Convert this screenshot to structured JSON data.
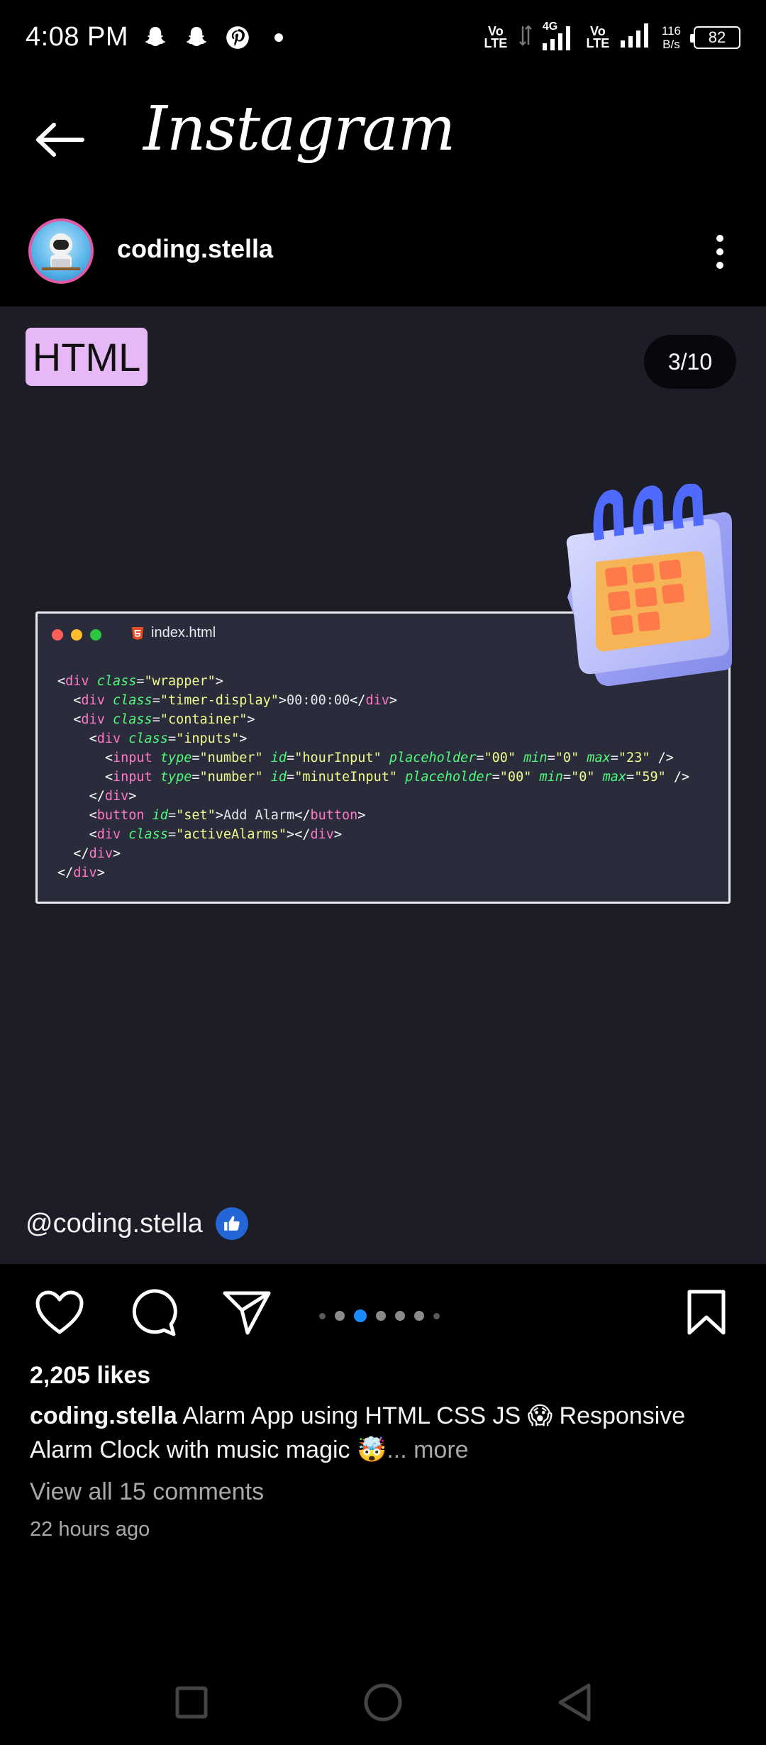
{
  "status_bar": {
    "time": "4:08 PM",
    "left_icons": [
      "snapchat-icon",
      "snapchat-icon",
      "pinterest-icon",
      "dot-icon"
    ],
    "volte_1": "Vo LTE",
    "network_type": "4G",
    "volte_2": "Vo LTE",
    "net_speed_value": "116",
    "net_speed_unit": "B/s",
    "battery": "82"
  },
  "app_bar": {
    "title": "Instagram"
  },
  "profile": {
    "username": "coding.stella"
  },
  "post": {
    "badge": "HTML",
    "counter": "3/10",
    "file_name": "index.html",
    "code_lines": [
      "<div class=\"wrapper\">",
      "  <div class=\"timer-display\">00:00:00</div>",
      "  <div class=\"container\">",
      "    <div class=\"inputs\">",
      "      <input type=\"number\" id=\"hourInput\" placeholder=\"00\" min=\"0\" max=\"23\" />",
      "      <input type=\"number\" id=\"minuteInput\" placeholder=\"00\" min=\"0\" max=\"59\" />",
      "    </div>",
      "    <button id=\"set\">Add Alarm</button>",
      "    <div class=\"activeAlarms\"></div>",
      "  </div>",
      "</div>"
    ],
    "watermark": "@coding.stella",
    "colors": {
      "background": "#1c1d26",
      "badge": "#e6b8f5",
      "active_dot": "#1a8cff"
    }
  },
  "carousel": {
    "total": 7,
    "active_index": 2
  },
  "caption": {
    "likes": "2,205 likes",
    "user": "coding.stella",
    "text": "Alarm App using HTML CSS JS 😱 Responsive Alarm Clock with music magic 🤯",
    "more": "... more",
    "view_comments": "View all 15 comments",
    "time_ago": "22 hours ago"
  },
  "nav": {
    "icons": [
      "recent-apps-icon",
      "home-icon",
      "back-icon"
    ]
  }
}
